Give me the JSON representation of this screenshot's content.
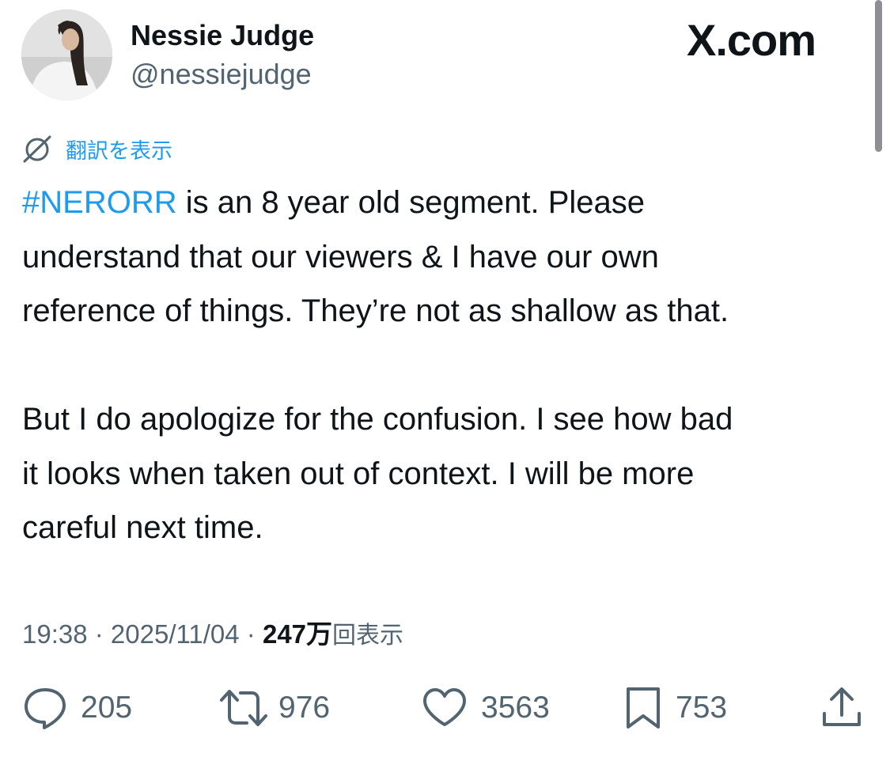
{
  "author": {
    "display_name": "Nessie Judge",
    "handle": "@nessiejudge"
  },
  "site_mark": "X.com",
  "translate": {
    "icon": "globe-slash-icon",
    "label": "翻訳を表示"
  },
  "tweet": {
    "hashtag": "#NERORR",
    "paragraph1_rest_line1": " is an 8 year old segment. Please",
    "paragraph1_line2": "understand that our viewers & I have our own",
    "paragraph1_line3": "reference of things. They’re not as shallow as that.",
    "paragraph2_line1": "But I do apologize for the confusion. I see how bad",
    "paragraph2_line2": "it looks when taken out of context. I will be more",
    "paragraph2_line3": "careful next time."
  },
  "meta": {
    "time": "19:38",
    "separator": " · ",
    "date": "2025/11/04",
    "views_number": "247万",
    "views_label": "回表示"
  },
  "actions": {
    "replies": "205",
    "reposts": "976",
    "likes": "3563",
    "bookmarks": "753"
  },
  "colors": {
    "link": "#1d9bf0",
    "text": "#0f1419",
    "secondary": "#536471"
  }
}
